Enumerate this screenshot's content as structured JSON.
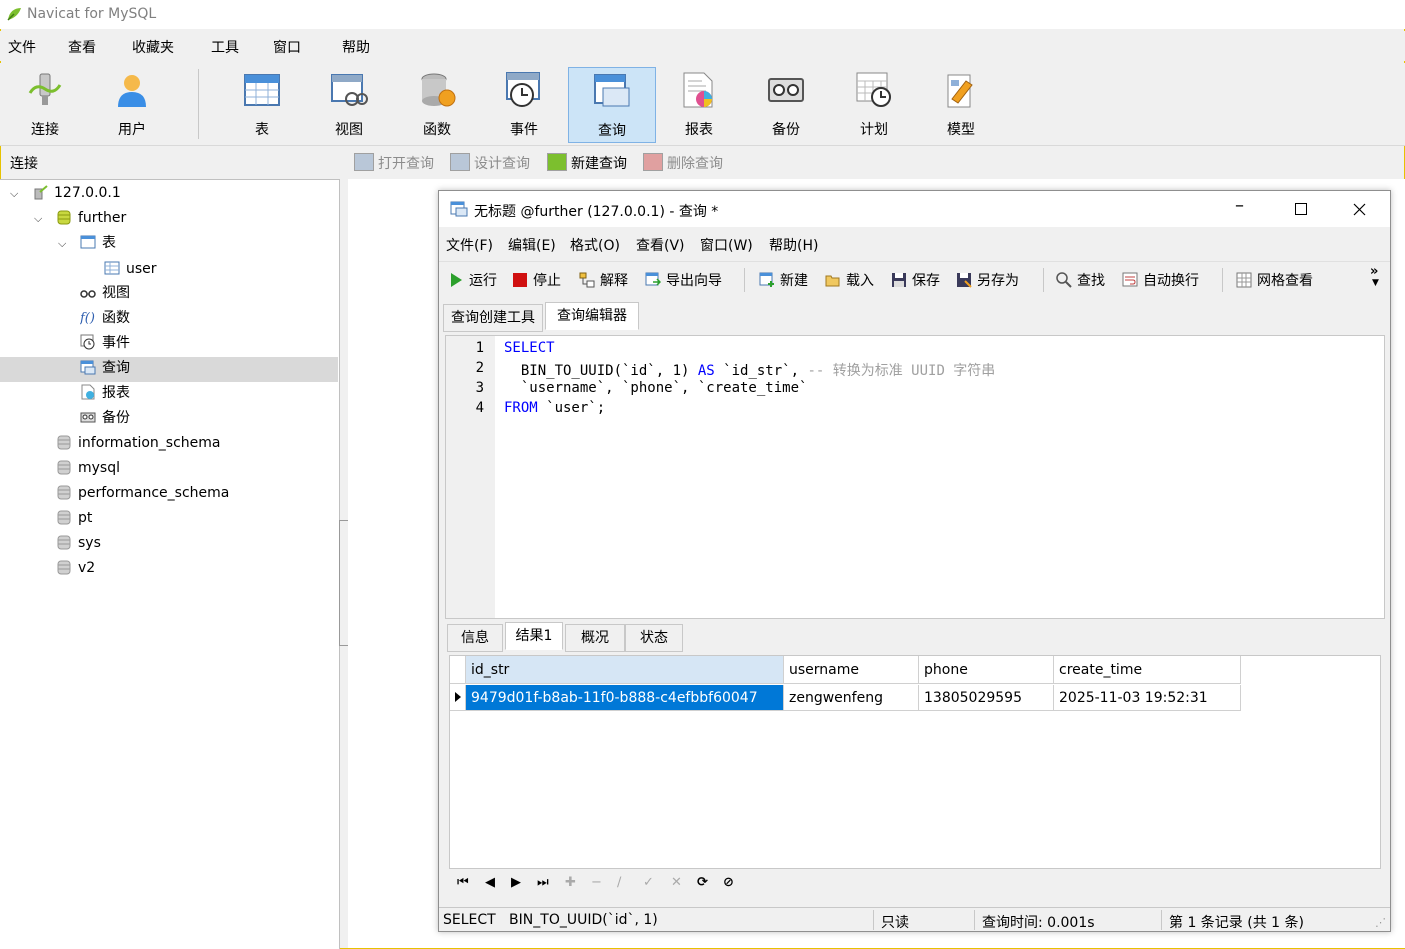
{
  "app": {
    "title": "Navicat for MySQL"
  },
  "menubar": [
    "文件",
    "查看",
    "收藏夹",
    "工具",
    "窗口",
    "帮助"
  ],
  "toolbar": [
    "连接",
    "用户",
    "表",
    "视图",
    "函数",
    "事件",
    "查询",
    "报表",
    "备份",
    "计划",
    "模型"
  ],
  "connection_pane": {
    "header": "连接",
    "tree": {
      "host": "127.0.0.1",
      "db": "further",
      "tables_label": "表",
      "table_user": "user",
      "views": "视图",
      "functions": "函数",
      "events": "事件",
      "queries": "查询",
      "reports": "报表",
      "backups": "备份",
      "databases": [
        "information_schema",
        "mysql",
        "performance_schema",
        "pt",
        "sys",
        "v2"
      ]
    }
  },
  "query_toolbar": [
    "打开查询",
    "设计查询",
    "新建查询",
    "删除查询"
  ],
  "query_window": {
    "title": "无标题 @further (127.0.0.1) - 查询 *",
    "menu": [
      "文件(F)",
      "编辑(E)",
      "格式(O)",
      "查看(V)",
      "窗口(W)",
      "帮助(H)"
    ],
    "toolbar": [
      "运行",
      "停止",
      "解释",
      "导出向导",
      "新建",
      "载入",
      "保存",
      "另存为",
      "查找",
      "自动换行",
      "网格查看"
    ],
    "tabs": [
      "查询创建工具",
      "查询编辑器"
    ],
    "editor": {
      "line_numbers": [
        "1",
        "2",
        "3",
        "4"
      ],
      "lines": {
        "l1_kw": "SELECT",
        "l2_a": "  BIN_TO_UUID(`id`, ",
        "l2_num": "1",
        "l2_b": ") ",
        "l2_kw": "AS",
        "l2_c": " `id_str`, ",
        "l2_comment": "-- 转换为标准 UUID 字符串",
        "l3": "  `username`, `phone`, `create_time`",
        "l4_kw": "FROM",
        "l4_rest": " `user`;"
      }
    },
    "result_tabs": [
      "信息",
      "结果1",
      "概况",
      "状态"
    ],
    "grid": {
      "columns": [
        "id_str",
        "username",
        "phone",
        "create_time"
      ],
      "rows": [
        [
          "9479d01f-b8ab-11f0-b888-c4efbbf60047",
          "zengwenfeng",
          "13805029595",
          "2025-11-03 19:52:31"
        ]
      ]
    },
    "status": {
      "sql": "SELECT   BIN_TO_UUID(`id`, 1)",
      "mode": "只读",
      "time": "查询时间: 0.001s",
      "records": "第 1 条记录 (共 1 条)"
    }
  },
  "colors": {
    "selection": "#0078d7",
    "keyword": "#0000ff",
    "comment": "#a0a0a0",
    "active_tool": "#cce4f7"
  }
}
